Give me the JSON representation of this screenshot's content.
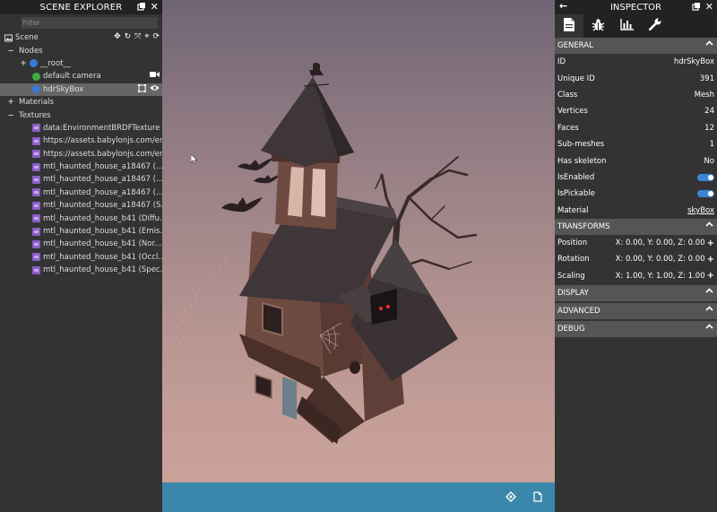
{
  "explorer": {
    "title": "SCENE EXPLORER",
    "filter_placeholder": "Filter",
    "scene_label": "Scene",
    "nodes_label": "Nodes",
    "nodes": [
      {
        "label": "__root__",
        "icon": "node-icon"
      },
      {
        "label": "default camera",
        "icon": "camera-node-icon"
      },
      {
        "label": "hdrSkyBox",
        "icon": "mesh-node-icon",
        "selected": true
      }
    ],
    "materials_label": "Materials",
    "textures_label": "Textures",
    "textures": [
      "data:EnvironmentBRDFTexture",
      "https://assets.babylonjs.com/en...",
      "https://assets.babylonjs.com/en...",
      "mtl_haunted_house_a18467 (...",
      "mtl_haunted_house_a18467 (...",
      "mtl_haunted_house_a18467 (...",
      "mtl_haunted_house_a18467 (S...",
      "mtl_haunted_house_b41 (Diffu...",
      "mtl_haunted_house_b41 (Emis...",
      "mtl_haunted_house_b41 (Nor...",
      "mtl_haunted_house_b41 (Occl...",
      "mtl_haunted_house_b41 (Spec..."
    ]
  },
  "inspector": {
    "title": "INSPECTOR",
    "tabs": [
      "properties-tab",
      "debug-tab",
      "statistics-tab",
      "tools-tab"
    ],
    "general": {
      "header": "GENERAL",
      "rows": [
        {
          "label": "ID",
          "value": "hdrSkyBox"
        },
        {
          "label": "Unique ID",
          "value": "391"
        },
        {
          "label": "Class",
          "value": "Mesh"
        },
        {
          "label": "Vertices",
          "value": "24"
        },
        {
          "label": "Faces",
          "value": "12"
        },
        {
          "label": "Sub-meshes",
          "value": "1"
        },
        {
          "label": "Has skeleton",
          "value": "No"
        },
        {
          "label": "IsEnabled",
          "value": "on"
        },
        {
          "label": "IsPickable",
          "value": "on"
        },
        {
          "label": "Material",
          "value": "skyBox"
        }
      ]
    },
    "transforms": {
      "header": "TRANSFORMS",
      "position_label": "Position",
      "position_value": "X: 0.00, Y: 0.00, Z: 0.00",
      "rotation_label": "Rotation",
      "rotation_value": "X: 0.00, Y: 0.00, Z: 0.00",
      "scaling_label": "Scaling",
      "scaling_value": "X: 1.00, Y: 1.00, Z: 1.00"
    },
    "display_header": "DISPLAY",
    "advanced_header": "ADVANCED",
    "debug_header": "DEBUG"
  },
  "colors": {
    "panel_bg": "#333333",
    "header_bg": "#222222",
    "section_bg": "#555555",
    "selected_row": "#666666",
    "accent": "#3a87d0",
    "bottom_bar": "#3a87ab"
  }
}
